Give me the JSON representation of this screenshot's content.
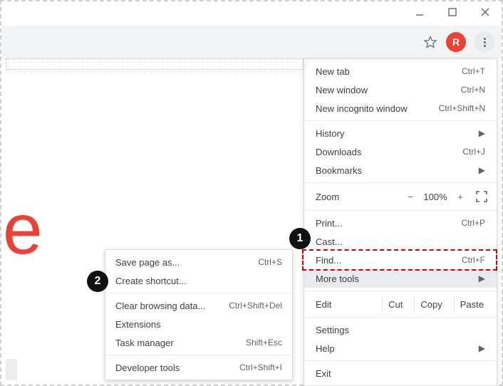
{
  "avatar_letter": "R",
  "big_letter": "e",
  "badges": {
    "one": "1",
    "two": "2"
  },
  "main_menu": {
    "new_tab": {
      "label": "New tab",
      "shortcut": "Ctrl+T"
    },
    "new_window": {
      "label": "New window",
      "shortcut": "Ctrl+N"
    },
    "new_incognito": {
      "label": "New incognito window",
      "shortcut": "Ctrl+Shift+N"
    },
    "history": {
      "label": "History"
    },
    "downloads": {
      "label": "Downloads",
      "shortcut": "Ctrl+J"
    },
    "bookmarks": {
      "label": "Bookmarks"
    },
    "zoom": {
      "label": "Zoom",
      "minus": "−",
      "value": "100%",
      "plus": "+"
    },
    "print": {
      "label": "Print...",
      "shortcut": "Ctrl+P"
    },
    "cast": {
      "label": "Cast..."
    },
    "find": {
      "label": "Find...",
      "shortcut": "Ctrl+F"
    },
    "more_tools": {
      "label": "More tools"
    },
    "edit": {
      "label": "Edit",
      "cut": "Cut",
      "copy": "Copy",
      "paste": "Paste"
    },
    "settings": {
      "label": "Settings"
    },
    "help": {
      "label": "Help"
    },
    "exit": {
      "label": "Exit"
    }
  },
  "sub_menu": {
    "save_page": {
      "label": "Save page as...",
      "shortcut": "Ctrl+S"
    },
    "create_shortcut": {
      "label": "Create shortcut..."
    },
    "clear_browsing": {
      "label": "Clear browsing data...",
      "shortcut": "Ctrl+Shift+Del"
    },
    "extensions": {
      "label": "Extensions"
    },
    "task_manager": {
      "label": "Task manager",
      "shortcut": "Shift+Esc"
    },
    "developer_tools": {
      "label": "Developer tools",
      "shortcut": "Ctrl+Shift+I"
    }
  }
}
